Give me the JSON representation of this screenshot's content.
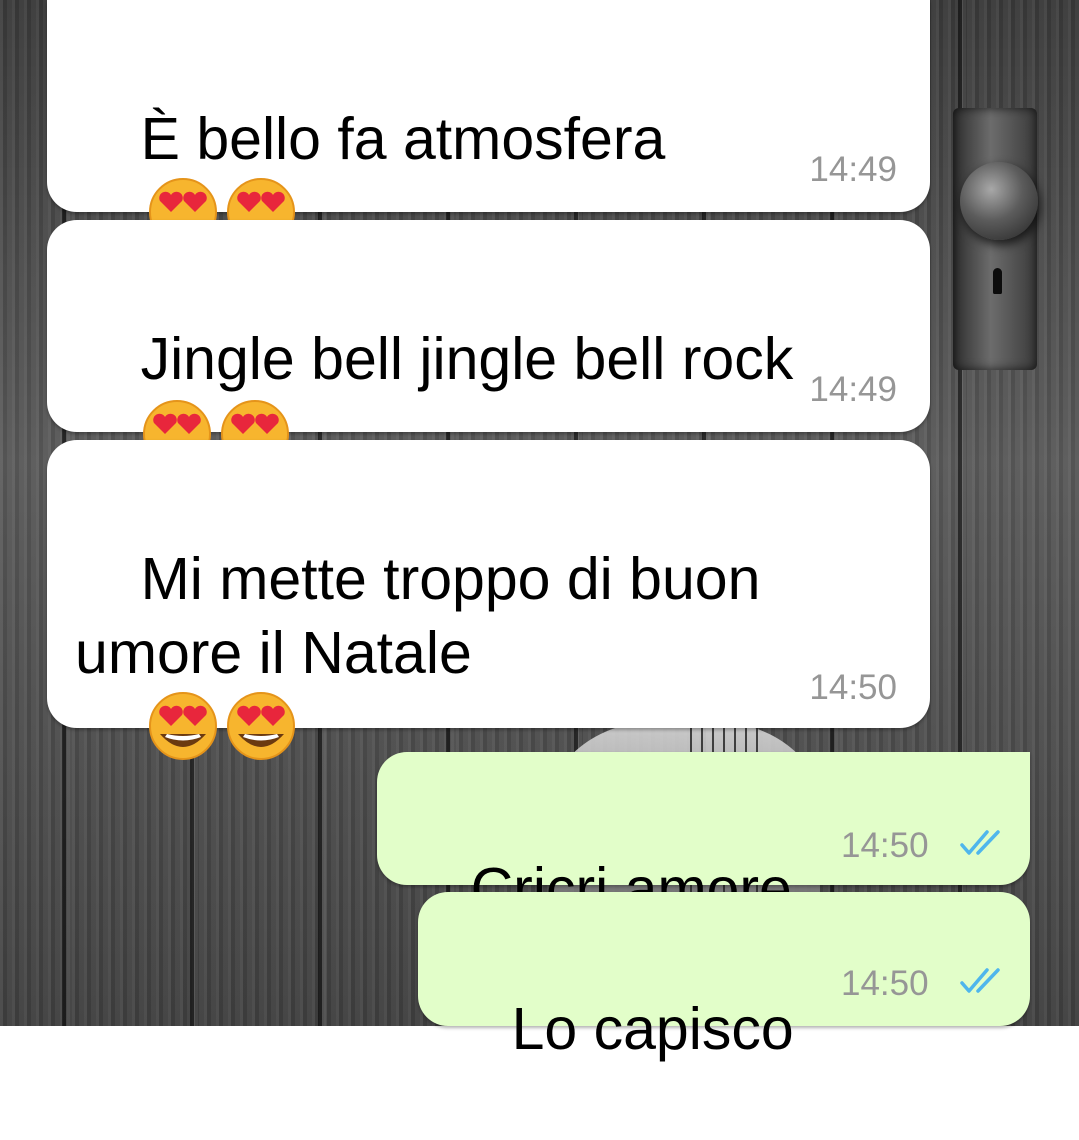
{
  "chat": {
    "messages": [
      {
        "direction": "incoming",
        "text": "È bello fa atmosfera",
        "emoji_count": 2,
        "emoji": "heart-eyes",
        "time": "14:49"
      },
      {
        "direction": "incoming",
        "text": "Jingle bell jingle bell rock",
        "emoji_count": 2,
        "emoji": "heart-eyes",
        "time": "14:49"
      },
      {
        "direction": "incoming",
        "text": "Mi mette troppo di buon umore il Natale",
        "emoji_count": 2,
        "emoji": "heart-eyes",
        "time": "14:50"
      },
      {
        "direction": "outgoing",
        "text": "Cricri amore",
        "emoji_count": 0,
        "time": "14:50",
        "status": "read",
        "status_icon": "double-check-icon"
      },
      {
        "direction": "outgoing",
        "text": "Lo capisco",
        "emoji_count": 0,
        "time": "14:50",
        "status": "read",
        "status_icon": "double-check-icon"
      }
    ]
  },
  "colors": {
    "incoming_bubble": "#ffffff",
    "outgoing_bubble": "#e2fec9",
    "message_text": "#000000",
    "timestamp": "#969696",
    "read_ticks": "#4fb6ec"
  },
  "background": {
    "description_icon": "dark-wood-wall-background"
  }
}
